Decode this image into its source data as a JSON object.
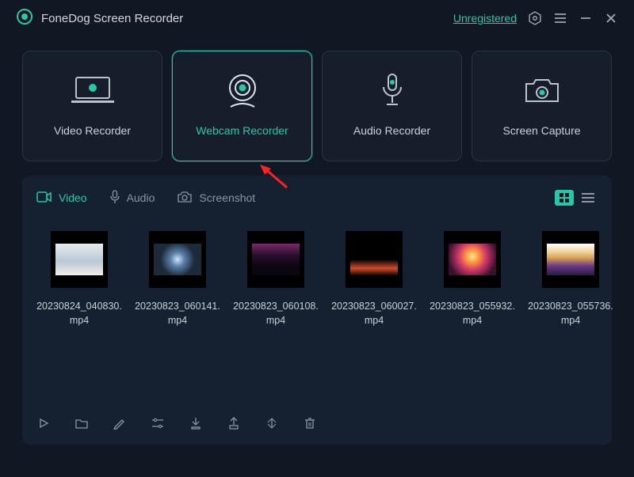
{
  "app": {
    "title": "FoneDog Screen Recorder"
  },
  "header": {
    "status": "Unregistered"
  },
  "modes": [
    {
      "label": "Video Recorder",
      "active": false
    },
    {
      "label": "Webcam Recorder",
      "active": true
    },
    {
      "label": "Audio Recorder",
      "active": false
    },
    {
      "label": "Screen Capture",
      "active": false
    }
  ],
  "tabs": {
    "video": "Video",
    "audio": "Audio",
    "screenshot": "Screenshot"
  },
  "files": [
    {
      "name": "20230824_040830.mp4"
    },
    {
      "name": "20230823_060141.mp4"
    },
    {
      "name": "20230823_060108.mp4"
    },
    {
      "name": "20230823_060027.mp4"
    },
    {
      "name": "20230823_055932.mp4"
    },
    {
      "name": "20230823_055736.mp4"
    }
  ],
  "colors": {
    "accent": "#24c9a9",
    "bg": "#111824"
  }
}
